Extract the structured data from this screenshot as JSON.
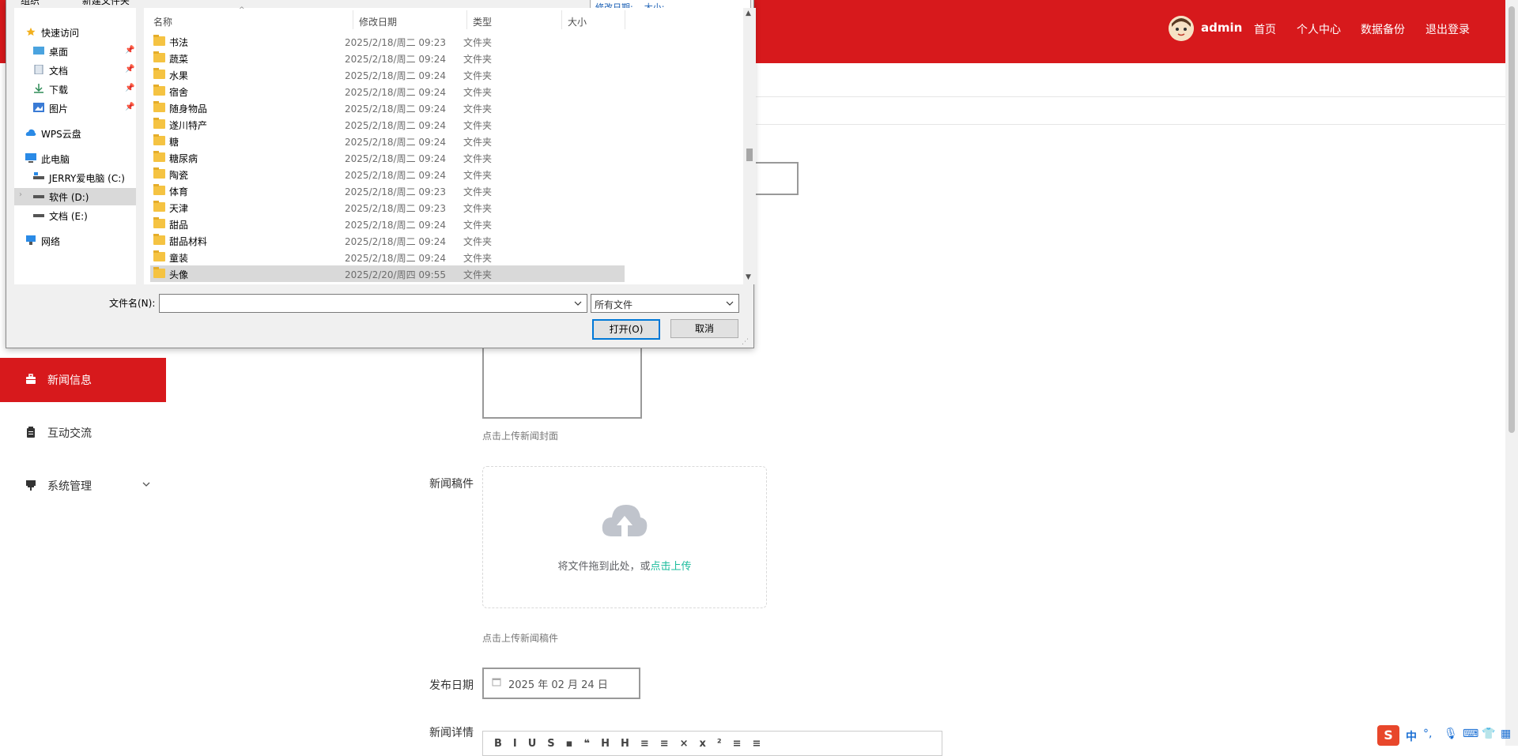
{
  "header": {
    "user": "admin",
    "nav": [
      "首页",
      "个人中心",
      "数据备份",
      "退出登录"
    ]
  },
  "sidebar": {
    "items": [
      {
        "label": "新闻信息",
        "active": true,
        "icon": "briefcase-icon"
      },
      {
        "label": "互动交流",
        "active": false,
        "icon": "clipboard-icon"
      },
      {
        "label": "系统管理",
        "active": false,
        "icon": "pin-icon"
      }
    ]
  },
  "form": {
    "cover_tip": "点击上传新闻封面",
    "file_label": "新闻稿件",
    "upload_text": "将文件拖到此处，或",
    "upload_link": "点击上传",
    "file_tip": "点击上传新闻稿件",
    "date_label": "发布日期",
    "date_value": "2025 年 02 月 24 日",
    "detail_label": "新闻详情"
  },
  "dialog": {
    "top_left": [
      "组织",
      "新建文件夹"
    ],
    "info_strip": "修改日期:    大小:",
    "nav": {
      "quick_access": "快速访问",
      "pinned": [
        "桌面",
        "文档",
        "下载",
        "图片"
      ],
      "wps_cloud": "WPS云盘",
      "this_pc": "此电脑",
      "drives": [
        "JERRY爱电脑 (C:)",
        "软件 (D:)",
        "文档 (E:)"
      ],
      "network": "网络"
    },
    "columns": [
      "名称",
      "修改日期",
      "类型",
      "大小"
    ],
    "rows": [
      {
        "name": "书法",
        "date": "2025/2/18/周二 09:23",
        "type": "文件夹"
      },
      {
        "name": "蔬菜",
        "date": "2025/2/18/周二 09:24",
        "type": "文件夹"
      },
      {
        "name": "水果",
        "date": "2025/2/18/周二 09:24",
        "type": "文件夹"
      },
      {
        "name": "宿舍",
        "date": "2025/2/18/周二 09:24",
        "type": "文件夹"
      },
      {
        "name": "随身物品",
        "date": "2025/2/18/周二 09:24",
        "type": "文件夹"
      },
      {
        "name": "遂川特产",
        "date": "2025/2/18/周二 09:24",
        "type": "文件夹"
      },
      {
        "name": "糖",
        "date": "2025/2/18/周二 09:24",
        "type": "文件夹"
      },
      {
        "name": "糖尿病",
        "date": "2025/2/18/周二 09:24",
        "type": "文件夹"
      },
      {
        "name": "陶瓷",
        "date": "2025/2/18/周二 09:24",
        "type": "文件夹"
      },
      {
        "name": "体育",
        "date": "2025/2/18/周二 09:23",
        "type": "文件夹"
      },
      {
        "name": "天津",
        "date": "2025/2/18/周二 09:23",
        "type": "文件夹"
      },
      {
        "name": "甜品",
        "date": "2025/2/18/周二 09:24",
        "type": "文件夹"
      },
      {
        "name": "甜品材料",
        "date": "2025/2/18/周二 09:24",
        "type": "文件夹"
      },
      {
        "name": "童装",
        "date": "2025/2/18/周二 09:24",
        "type": "文件夹"
      },
      {
        "name": "头像",
        "date": "2025/2/20/周四 09:55",
        "type": "文件夹"
      }
    ],
    "filename_label": "文件名(N):",
    "filename_value": "",
    "filetype": "所有文件",
    "open": "打开(O)",
    "cancel": "取消"
  },
  "ime": {
    "label": "中"
  }
}
